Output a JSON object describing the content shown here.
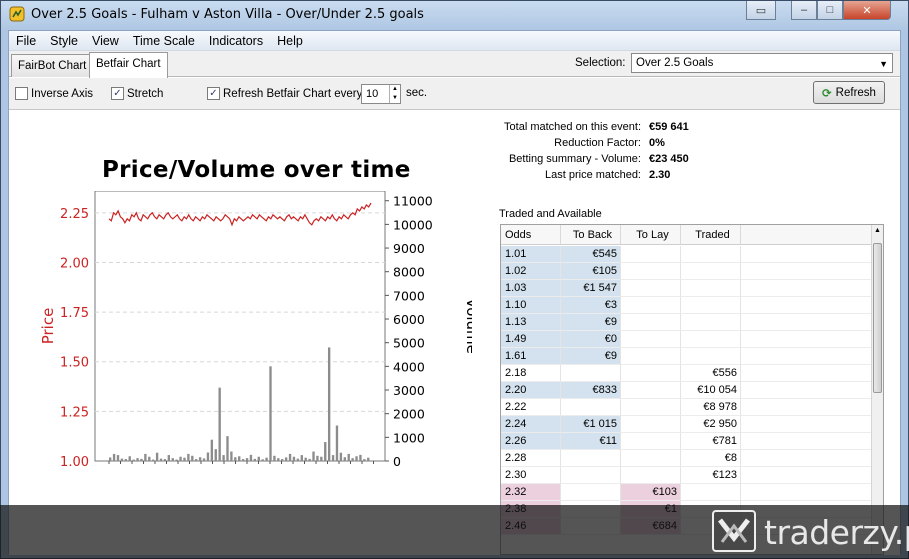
{
  "window": {
    "title": "Over 2.5 Goals - Fulham v Aston Villa - Over/Under 2.5 goals"
  },
  "menu": [
    "File",
    "Style",
    "View",
    "Time Scale",
    "Indicators",
    "Help"
  ],
  "tabs": [
    {
      "label": "FairBot Chart",
      "active": false
    },
    {
      "label": "Betfair Chart",
      "active": true
    }
  ],
  "selection": {
    "label": "Selection:",
    "value": "Over 2.5 Goals"
  },
  "toolbar": {
    "inverse_axis": {
      "label": "Inverse Axis",
      "checked": false
    },
    "stretch": {
      "label": "Stretch",
      "checked": true
    },
    "refresh_every": {
      "label": "Refresh Betfair Chart every",
      "checked": true,
      "value": "10",
      "unit": "sec."
    },
    "refresh_button": "Refresh"
  },
  "summary": [
    {
      "label": "Total matched on this event:",
      "value": "€59 641"
    },
    {
      "label": "Reduction Factor:",
      "value": "0%"
    },
    {
      "label": "Betting summary - Volume:",
      "value": "€23 450"
    },
    {
      "label": "Last price matched:",
      "value": "2.30"
    }
  ],
  "traded": {
    "title": "Traded and Available",
    "columns": [
      "Odds",
      "To Back",
      "To Lay",
      "Traded"
    ],
    "rows": [
      {
        "odds": "1.01",
        "back": "€545",
        "lay": "",
        "traded": ""
      },
      {
        "odds": "1.02",
        "back": "€105",
        "lay": "",
        "traded": ""
      },
      {
        "odds": "1.03",
        "back": "€1 547",
        "lay": "",
        "traded": ""
      },
      {
        "odds": "1.10",
        "back": "€3",
        "lay": "",
        "traded": ""
      },
      {
        "odds": "1.13",
        "back": "€9",
        "lay": "",
        "traded": ""
      },
      {
        "odds": "1.49",
        "back": "€0",
        "lay": "",
        "traded": ""
      },
      {
        "odds": "1.61",
        "back": "€9",
        "lay": "",
        "traded": ""
      },
      {
        "odds": "2.18",
        "back": "",
        "lay": "",
        "traded": "€556"
      },
      {
        "odds": "2.20",
        "back": "€833",
        "lay": "",
        "traded": "€10 054"
      },
      {
        "odds": "2.22",
        "back": "",
        "lay": "",
        "traded": "€8 978"
      },
      {
        "odds": "2.24",
        "back": "€1 015",
        "lay": "",
        "traded": "€2 950"
      },
      {
        "odds": "2.26",
        "back": "€11",
        "lay": "",
        "traded": "€781"
      },
      {
        "odds": "2.28",
        "back": "",
        "lay": "",
        "traded": "€8"
      },
      {
        "odds": "2.30",
        "back": "",
        "lay": "",
        "traded": "€123"
      },
      {
        "odds": "2.32",
        "back": "",
        "lay": "€103",
        "traded": ""
      },
      {
        "odds": "2.38",
        "back": "",
        "lay": "€1",
        "traded": ""
      },
      {
        "odds": "2.46",
        "back": "",
        "lay": "€684",
        "traded": ""
      }
    ]
  },
  "colors": {
    "price_line": "#cc2222",
    "volume_bar": "#8c8c8c",
    "back": "#d3e2ee",
    "lay": "#ecd0de"
  },
  "watermark": {
    "text": "traderzy.pl"
  },
  "chart_data": {
    "type": "line",
    "title": "Price/Volume over time",
    "ylabel": "Price",
    "y2label": "Volume",
    "yticks": [
      "1.00",
      "1.25",
      "1.50",
      "1.75",
      "2.00",
      "2.25"
    ],
    "y2ticks": [
      "0",
      "1000",
      "2000",
      "3000",
      "4000",
      "5000",
      "6000",
      "7000",
      "8000",
      "9000",
      "10000",
      "11000"
    ],
    "ylim": [
      1.0,
      2.36
    ],
    "y2lim": [
      0,
      11000
    ],
    "grid": true,
    "series": [
      {
        "axis": "left",
        "values": [
          2.22,
          2.21,
          2.25,
          2.24,
          2.26,
          2.23,
          2.22,
          2.2,
          2.22,
          2.21,
          2.24,
          2.23,
          2.25,
          2.22,
          2.21,
          2.24,
          2.23,
          2.22,
          2.24,
          2.25,
          2.23,
          2.22,
          2.24,
          2.23,
          2.22,
          2.24,
          2.25,
          2.23,
          2.22,
          2.23,
          2.24,
          2.22,
          2.21,
          2.23,
          2.22,
          2.24,
          2.22,
          2.21,
          2.23,
          2.22,
          2.21,
          2.23,
          2.22,
          2.24,
          2.23,
          2.22,
          2.21,
          2.23,
          2.22,
          2.21,
          2.22,
          2.24,
          2.23,
          2.22,
          2.19,
          2.22,
          2.21,
          2.23,
          2.22,
          2.21,
          2.22,
          2.23,
          2.22,
          2.24,
          2.23,
          2.22,
          2.24,
          2.23,
          2.22,
          2.21,
          2.23,
          2.22,
          2.24,
          2.23,
          2.22,
          2.23,
          2.22,
          2.21,
          2.23,
          2.24,
          2.22,
          2.23,
          2.22,
          2.21,
          2.23,
          2.22,
          2.24,
          2.22,
          2.2,
          2.19,
          2.21,
          2.22,
          2.21,
          2.23,
          2.22,
          2.21,
          2.23,
          2.22,
          2.24,
          2.22,
          2.21,
          2.23,
          2.22,
          2.24,
          2.23,
          2.22,
          2.24,
          2.25,
          2.24,
          2.27,
          2.26,
          2.28,
          2.27,
          2.29,
          2.28,
          2.3
        ]
      },
      {
        "axis": "right",
        "type": "bar",
        "values": [
          150,
          300,
          250,
          100,
          80,
          200,
          60,
          120,
          90,
          300,
          180,
          60,
          350,
          100,
          80,
          250,
          120,
          60,
          180,
          140,
          300,
          220,
          80,
          160,
          110,
          360,
          900,
          500,
          3100,
          250,
          1050,
          400,
          160,
          200,
          80,
          120,
          260,
          90,
          180,
          70,
          140,
          4000,
          220,
          120,
          80,
          150,
          300,
          180,
          100,
          250,
          140,
          90,
          400,
          220,
          180,
          800,
          4800,
          250,
          1500,
          350,
          160,
          300,
          120,
          200,
          260,
          80,
          140
        ]
      }
    ]
  }
}
